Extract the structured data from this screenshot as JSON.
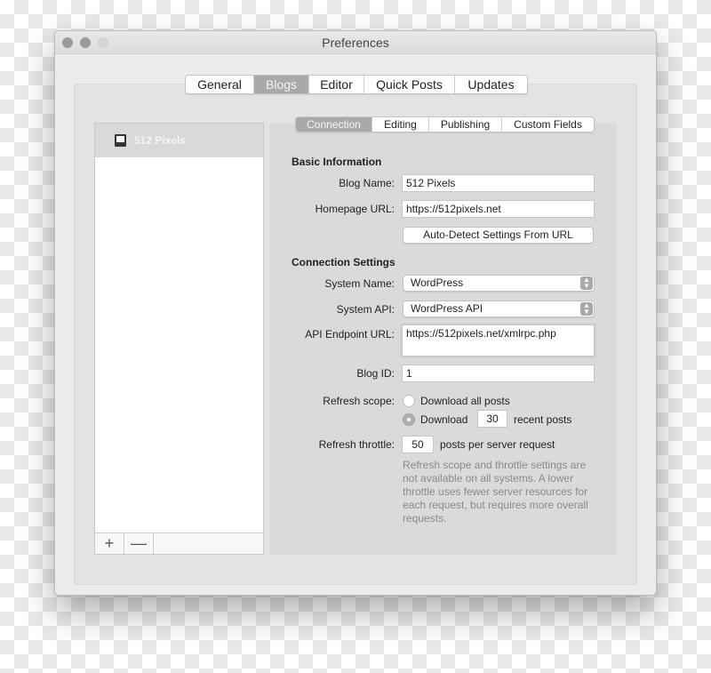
{
  "window": {
    "title": "Preferences"
  },
  "main_tabs": [
    {
      "label": "General",
      "active": false
    },
    {
      "label": "Blogs",
      "active": true
    },
    {
      "label": "Editor",
      "active": false
    },
    {
      "label": "Quick Posts",
      "active": false
    },
    {
      "label": "Updates",
      "active": false
    }
  ],
  "sidebar": {
    "items": [
      {
        "label": "512 Pixels",
        "selected": true
      }
    ],
    "add_label": "+",
    "remove_label": "—"
  },
  "sub_tabs": [
    {
      "label": "Connection",
      "active": true
    },
    {
      "label": "Editing",
      "active": false
    },
    {
      "label": "Publishing",
      "active": false
    },
    {
      "label": "Custom Fields",
      "active": false
    }
  ],
  "basic_info": {
    "section_title": "Basic Information",
    "blog_name_label": "Blog Name:",
    "blog_name_value": "512 Pixels",
    "homepage_url_label": "Homepage URL:",
    "homepage_url_value": "https://512pixels.net",
    "auto_detect_button": "Auto-Detect Settings From URL"
  },
  "connection": {
    "section_title": "Connection Settings",
    "system_name_label": "System Name:",
    "system_name_value": "WordPress",
    "system_api_label": "System API:",
    "system_api_value": "WordPress API",
    "api_endpoint_label": "API Endpoint URL:",
    "api_endpoint_value": "https://512pixels.net/xmlrpc.php",
    "blog_id_label": "Blog ID:",
    "blog_id_value": "1",
    "refresh_scope_label": "Refresh scope:",
    "option_all_posts": "Download all posts",
    "option_download": "Download",
    "recent_count": "30",
    "recent_posts_suffix": "recent posts",
    "selected_scope": "recent",
    "refresh_throttle_label": "Refresh throttle:",
    "throttle_value": "50",
    "throttle_suffix": "posts per server request",
    "help_text": "Refresh scope and throttle settings are not available on all systems. A lower throttle uses fewer server resources for each request, but requires more overall requests."
  },
  "icons": {
    "blog_item": "blog-window-icon",
    "select_arrows": "updown-chevrons-icon"
  },
  "colors": {
    "active_tab": "#a9a9a9",
    "selection": "#d9d9d9",
    "panel": "#dadada"
  }
}
